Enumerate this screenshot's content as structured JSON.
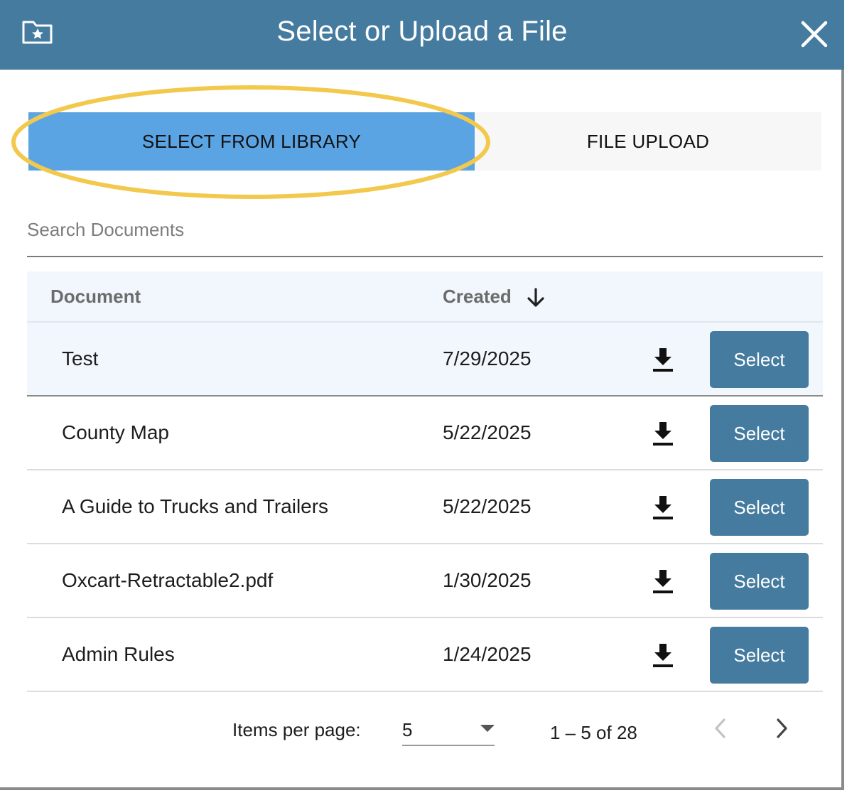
{
  "dialog": {
    "title": "Select or Upload a File",
    "icon": "folder-star-icon",
    "close_icon": "close-icon"
  },
  "tabs": [
    {
      "label": "SELECT FROM LIBRARY",
      "active": true
    },
    {
      "label": "FILE UPLOAD",
      "active": false
    }
  ],
  "search": {
    "placeholder": "Search Documents",
    "value": ""
  },
  "table": {
    "columns": {
      "document": "Document",
      "created": "Created",
      "sort_icon": "arrow-down-icon"
    },
    "select_label": "Select",
    "download_icon": "download-icon",
    "rows": [
      {
        "document": "Test",
        "created": "7/29/2025"
      },
      {
        "document": "County Map",
        "created": "5/22/2025"
      },
      {
        "document": "A Guide to Trucks and Trailers",
        "created": "5/22/2025"
      },
      {
        "document": "Oxcart-Retractable2.pdf",
        "created": "1/30/2025"
      },
      {
        "document": "Admin Rules",
        "created": "1/24/2025"
      }
    ]
  },
  "paginator": {
    "items_per_page_label": "Items per page:",
    "items_per_page_value": "5",
    "range_label": "1 – 5 of 28",
    "prev_icon": "chevron-left-icon",
    "next_icon": "chevron-right-icon"
  },
  "colors": {
    "header_bg": "#447b9f",
    "active_tab": "#5ba4e3",
    "highlight_ring": "#f2c94c",
    "button_bg": "#447b9f",
    "header_row_bg": "#f1f7fd"
  }
}
